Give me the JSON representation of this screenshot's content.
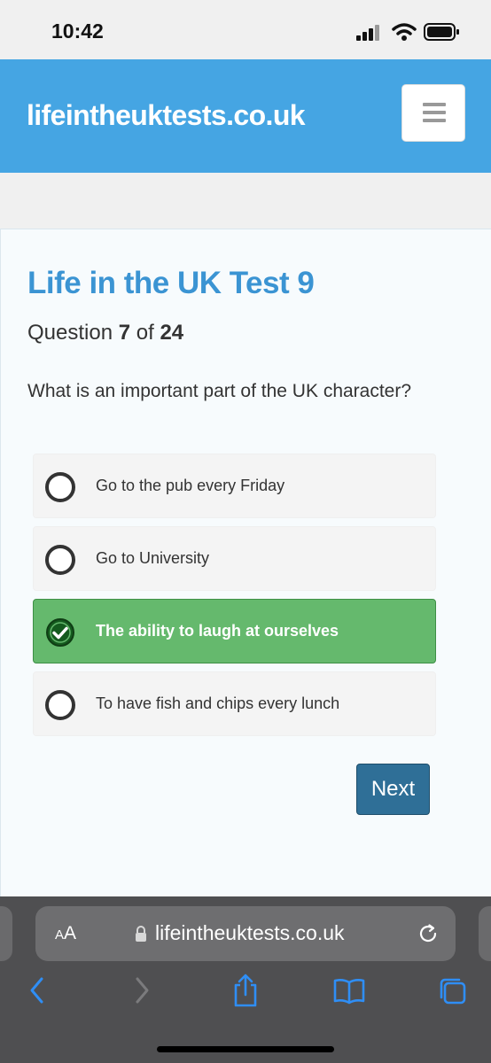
{
  "status_bar": {
    "time": "10:42"
  },
  "header": {
    "logo": "lifeintheuktests.co.uk"
  },
  "test": {
    "title": "Life in the UK Test 9",
    "question_prefix": "Question",
    "question_number": "7",
    "question_of": "of",
    "question_total": "24",
    "question": "What is an important part of the UK character?"
  },
  "options": [
    {
      "label": "Go to the pub every Friday",
      "selected": false
    },
    {
      "label": "Go to University",
      "selected": false
    },
    {
      "label": "The ability to laugh at ourselves",
      "selected": true
    },
    {
      "label": "To have fish and chips every lunch",
      "selected": false
    }
  ],
  "next_label": "Next",
  "browser": {
    "aa_label_small": "A",
    "aa_label_large": "A",
    "url": "lifeintheuktests.co.uk"
  },
  "colors": {
    "header_bg": "#45a5e3",
    "title": "#3b94d3",
    "selected_bg": "#65b96d",
    "next_bg": "#2f6f97",
    "safari_icon": "#2f8ef5"
  },
  "icons": [
    "signal-icon",
    "wifi-icon",
    "battery-icon",
    "menu-icon",
    "check-icon",
    "lock-icon",
    "reload-icon",
    "back-icon",
    "forward-icon",
    "share-icon",
    "bookmarks-icon",
    "tabs-icon"
  ]
}
